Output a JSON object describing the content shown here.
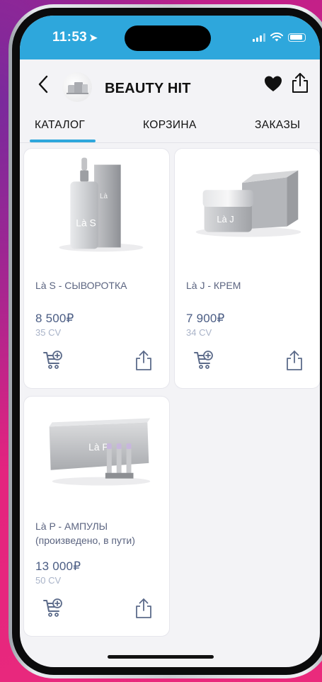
{
  "status_bar": {
    "time": "11:53"
  },
  "header": {
    "shop_name": "BEAUTY HIT"
  },
  "tabs": [
    {
      "label": "КАТАЛОГ",
      "active": true
    },
    {
      "label": "КОРЗИНА",
      "active": false
    },
    {
      "label": "ЗАКАЗЫ",
      "active": false
    }
  ],
  "products": [
    {
      "name": "Là S - СЫВОРОТКА",
      "price": "8 500₽",
      "cv": "35 CV",
      "pack_label": "Là S"
    },
    {
      "name": "Là J - КРЕМ",
      "price": "7 900₽",
      "cv": "34 CV",
      "pack_label": "Là J"
    },
    {
      "name_line1": "Là P - АМПУЛЫ",
      "name_line2": "(произведено, в пути)",
      "price": "13 000₽",
      "cv": "50 CV",
      "pack_label": "Là P"
    }
  ],
  "colors": {
    "accent": "#2ea7dc",
    "price": "#4b5d84",
    "cv": "#a9b3c8",
    "background": "#f3f3f6"
  },
  "icons": [
    "back-icon",
    "heart-icon",
    "share-icon",
    "cart-add-icon",
    "location-arrow-icon",
    "signal-icon",
    "wifi-icon",
    "battery-icon"
  ]
}
